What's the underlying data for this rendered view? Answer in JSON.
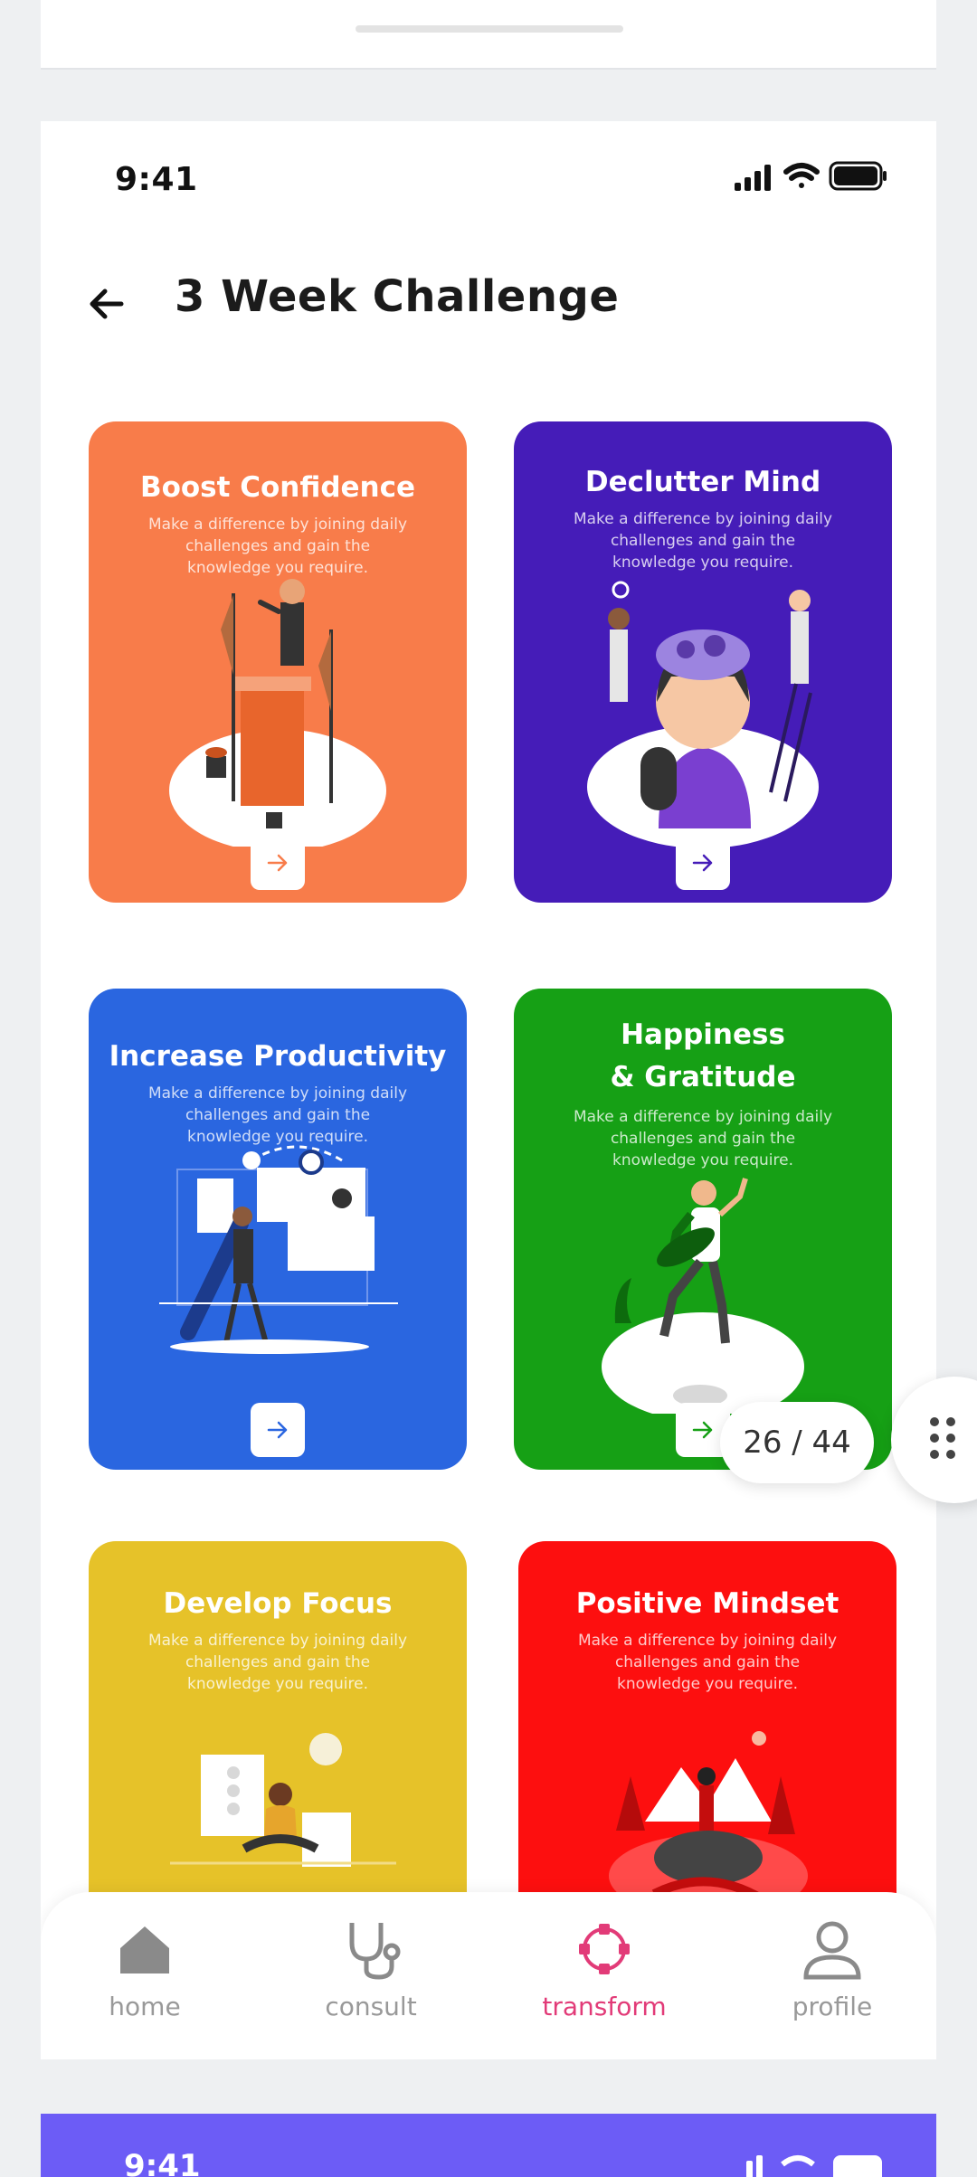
{
  "status_bar": {
    "time": "9:41"
  },
  "header": {
    "title": "3 Week Challenge",
    "back_icon": "arrow-left-icon"
  },
  "cards": [
    {
      "title": "Boost Confidence",
      "description": "Make a difference by joining daily challenges and gain the knowledge you require.",
      "color": "#f87c4a",
      "arrow_color": "#f87c4a"
    },
    {
      "title": "Declutter Mind",
      "description": "Make a difference by joining daily challenges and gain the knowledge you require.",
      "color": "#451cb8",
      "arrow_color": "#451cb8"
    },
    {
      "title": "Increase Productivity",
      "description": "Make a difference by joining daily challenges and gain the knowledge you require.",
      "color": "#2a66e0",
      "arrow_color": "#2a66e0"
    },
    {
      "title": "Happiness & Gratitude",
      "description": "Make a difference by joining daily challenges and gain the knowledge you require.",
      "color": "#16a015",
      "arrow_color": "#16a015"
    },
    {
      "title": "Develop Focus",
      "description": "Make a difference by joining daily challenges and gain the knowledge you require.",
      "color": "#e6c229",
      "arrow_color": "#e6c229"
    },
    {
      "title": "Positive  Mindset",
      "description": "Make a difference by joining daily challenges and gain the knowledge you require.",
      "color": "#fd0f0f",
      "arrow_color": "#fd0f0f"
    }
  ],
  "pager": {
    "text": "26 / 44"
  },
  "bottom_nav": {
    "items": [
      {
        "label": "home",
        "icon": "home-icon",
        "active": false
      },
      {
        "label": "consult",
        "icon": "stethoscope-icon",
        "active": false
      },
      {
        "label": "transform",
        "icon": "transform-icon",
        "active": true
      },
      {
        "label": "profile",
        "icon": "profile-icon",
        "active": false
      }
    ],
    "active_color": "#e23b78",
    "inactive_color": "#999999"
  },
  "next_screen": {
    "time": "9:41"
  }
}
